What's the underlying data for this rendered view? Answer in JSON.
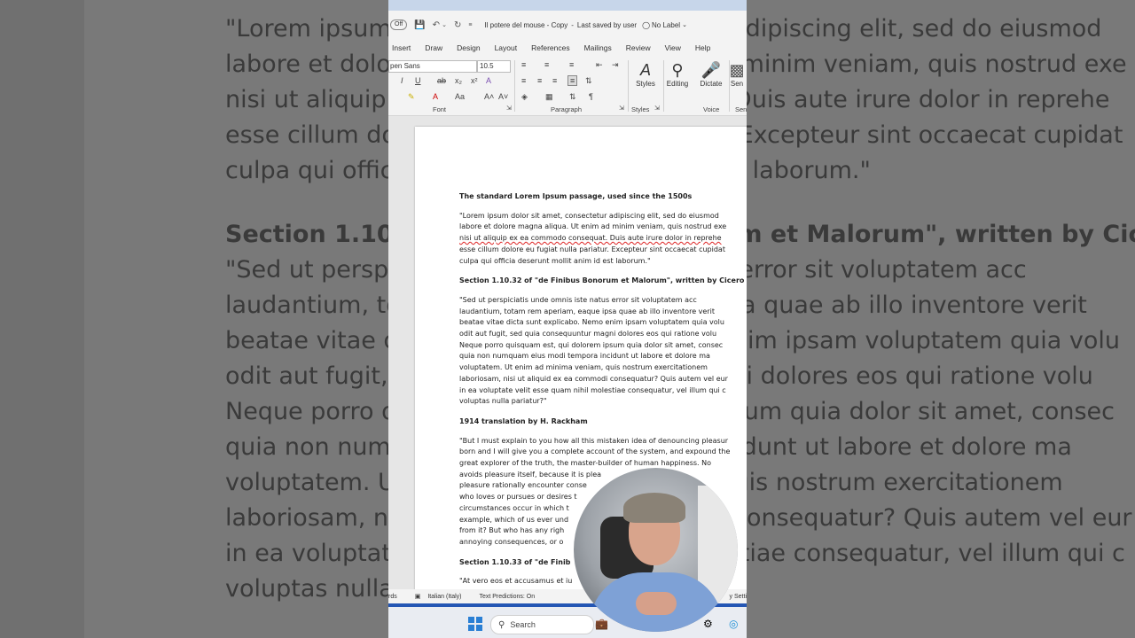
{
  "background": {
    "lines": [
      {
        "text": "\"Lorem ipsum dolor sit amet, consectetur adipiscing elit, sed do eiusmod",
        "heading": false
      },
      {
        "text": "labore et dolore magna aliqua. Ut enim ad minim veniam, quis nostrud exe",
        "heading": false
      },
      {
        "text": "nisi ut aliquip ex ea commodo consequat. Duis aute irure dolor in reprehe",
        "heading": false
      },
      {
        "text": "esse cillum dolore eu fugiat nulla pariatur. Excepteur sint occaecat cupidat",
        "heading": false
      },
      {
        "text": "culpa qui officia deserunt mollit anim id est laborum.\"",
        "heading": false
      },
      {
        "text": "Section 1.10.32 of \"de Finibus Bonorum et Malorum\", written by Cicero",
        "heading": true
      },
      {
        "text": "\"Sed ut perspiciatis unde omnis iste natus error sit voluptatem acc",
        "heading": false
      },
      {
        "text": "laudantium, totam rem aperiam, eaque ipsa quae ab illo inventore verit",
        "heading": false
      },
      {
        "text": "beatae vitae dicta sunt explicabo. Nemo enim ipsam voluptatem quia volu",
        "heading": false
      },
      {
        "text": "odit aut fugit, sed quia consequuntur magni dolores eos qui ratione volu",
        "heading": false
      },
      {
        "text": "Neque porro quisquam est, qui dolorem ipsum quia dolor sit amet, consec",
        "heading": false
      },
      {
        "text": "quia non numquam eius modi tempora incidunt ut labore et dolore ma",
        "heading": false
      },
      {
        "text": "voluptatem. Ut enim ad minima veniam, quis nostrum exercitationem",
        "heading": false
      },
      {
        "text": "laboriosam, nisi ut aliquid ex ea commodi consequatur? Quis autem vel eur",
        "heading": false
      },
      {
        "text": "in ea voluptate velit esse quam nihil molestiae consequatur, vel illum qui c",
        "heading": false
      },
      {
        "text": "voluptas nulla pariatur?\"",
        "heading": false
      }
    ]
  },
  "titlebar": {
    "autosave": "Off",
    "title": "Il potere del mouse - Copy",
    "saved": "Last saved by user",
    "label": "No Label"
  },
  "tabs": [
    "Insert",
    "Draw",
    "Design",
    "Layout",
    "References",
    "Mailings",
    "Review",
    "View",
    "Help"
  ],
  "ribbon": {
    "font": "pen Sans",
    "size": "10.5",
    "groups": {
      "font": "Font",
      "paragraph": "Paragraph",
      "styles": "Styles",
      "voice": "Voice",
      "sens": "Sen"
    },
    "buttons": {
      "styles": "Styles",
      "editing": "Editing",
      "dictate": "Dictate",
      "sens": "Sen"
    }
  },
  "document": {
    "heading1": "The standard Lorem Ipsum passage, used since the 1500s",
    "p1": [
      "\"Lorem ipsum dolor sit amet, consectetur adipiscing elit, sed do eiusmod",
      "labore et dolore magna aliqua. Ut enim ad minim veniam, quis nostrud exe",
      "nisi ut aliquip ex ea commodo consequat. Duis aute irure dolor in reprehe",
      "esse cillum dolore eu fugiat nulla pariatur. Excepteur sint occaecat cupidat",
      "culpa qui officia deserunt mollit anim id est laborum.\""
    ],
    "heading2": "Section 1.10.32 of \"de Finibus Bonorum et Malorum\", written by Cicero",
    "p2": [
      "\"Sed ut perspiciatis unde omnis iste natus error sit voluptatem acc",
      "laudantium, totam rem aperiam, eaque ipsa quae ab illo inventore verit",
      "beatae vitae dicta sunt explicabo. Nemo enim ipsam voluptatem quia volu",
      "odit aut fugit, sed quia consequuntur magni dolores eos qui ratione volu",
      "Neque porro quisquam est, qui dolorem ipsum quia dolor sit amet, consec",
      "quia non numquam eius modi tempora incidunt ut labore et dolore ma",
      "voluptatem. Ut enim ad minima veniam, quis nostrum exercitationem",
      "laboriosam, nisi ut aliquid ex ea commodi consequatur? Quis autem vel eur",
      "in ea voluptate velit esse quam nihil molestiae consequatur, vel illum qui c",
      "voluptas nulla pariatur?\""
    ],
    "heading3": "1914 translation by H. Rackham",
    "p3": [
      "\"But I must explain to you how all this mistaken idea of denouncing pleasur",
      "born and I will give you a complete account of the system, and expound the",
      "great explorer of the truth, the master-builder of human happiness. No",
      "avoids pleasure itself, because it is plea",
      "pleasure rationally encounter conse",
      "who loves or pursues or desires t",
      "circumstances occur in which t",
      "example, which of us ever und",
      "from it? But who has any righ",
      "annoying consequences, or o"
    ],
    "heading4": "Section 1.10.33 of \"de Finib",
    "p4": [
      "\"At vero eos et accusamus et iu"
    ]
  },
  "statusbar": {
    "words": "rds",
    "language": "Italian (Italy)",
    "predictions": "Text Predictions: On",
    "settings": "y Setti"
  },
  "taskbar": {
    "search": "Search"
  }
}
